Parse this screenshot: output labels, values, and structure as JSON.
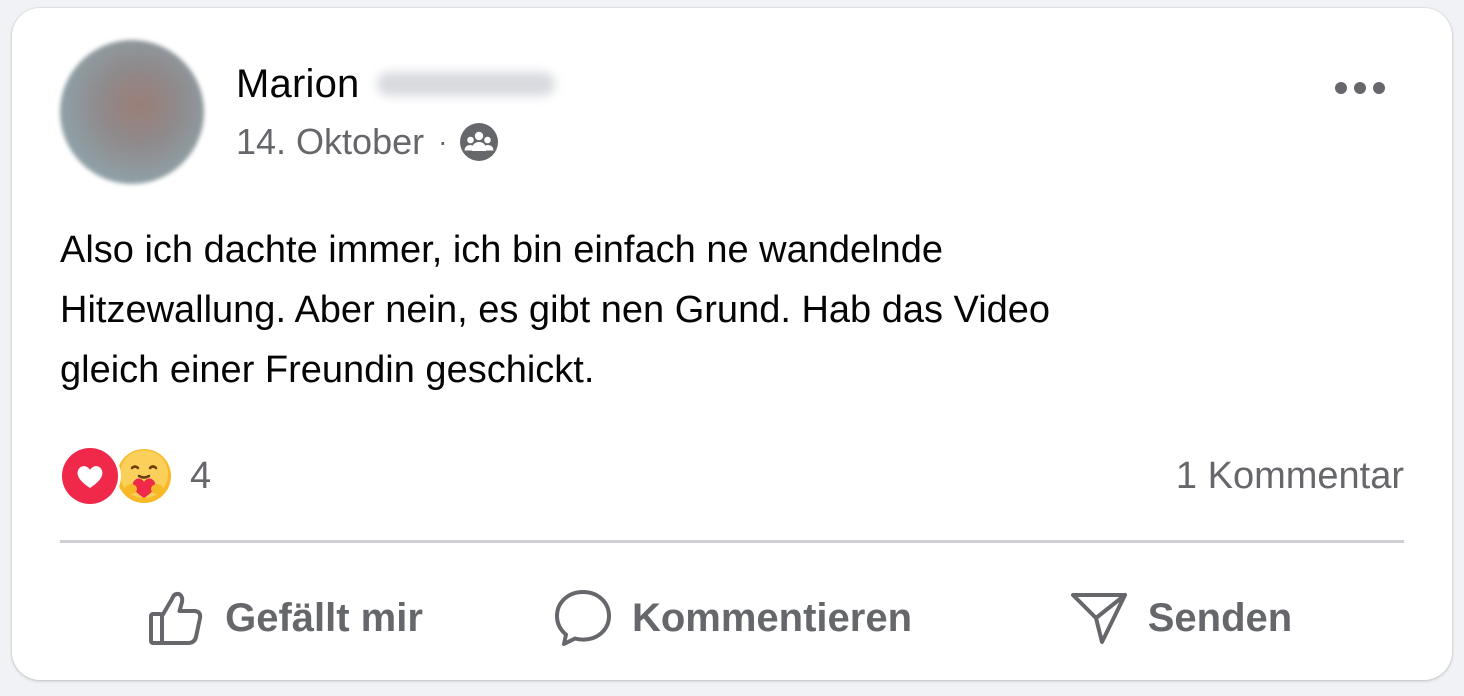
{
  "post": {
    "author": {
      "first_name": "Marion",
      "surname_redacted": true
    },
    "date": "14. Oktober",
    "separator": "·",
    "audience_icon": "friends-group-icon",
    "more_icon": "more-horizontal-icon",
    "text": "Also ich dachte immer, ich bin einfach ne wandelnde\nHitzewallung. Aber nein, es gibt nen Grund. Hab das Video\ngleich einer Freundin geschickt.",
    "reactions": {
      "types": [
        "love-reaction-icon",
        "care-reaction-icon"
      ],
      "count": "4"
    },
    "comments_label": "1 Kommentar",
    "actions": [
      {
        "icon": "thumbs-up-icon",
        "label": "Gefällt mir"
      },
      {
        "icon": "comment-bubble-icon",
        "label": "Kommentieren"
      },
      {
        "icon": "send-icon",
        "label": "Senden"
      }
    ]
  },
  "colors": {
    "text_primary": "#050505",
    "text_secondary": "#65676b",
    "divider": "#ced0d4",
    "love_red": "#f0284a",
    "care_yellow": "#f7b928"
  }
}
